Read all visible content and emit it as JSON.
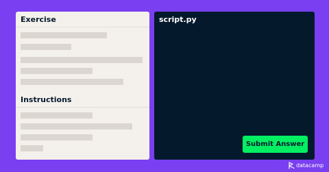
{
  "exercise": {
    "title": "Exercise"
  },
  "instructions": {
    "title": "Instructions"
  },
  "editor": {
    "filename": "script.py",
    "submit_label": "Submit Answer"
  },
  "brand": {
    "logo_icon": "datacamp-logo-icon",
    "name": "datacamp"
  },
  "colors": {
    "background": "#7a3ff0",
    "panel": "#f4f1ec",
    "placeholder": "#dbd6cf",
    "editor": "#05192d",
    "submit": "#03ef62"
  }
}
